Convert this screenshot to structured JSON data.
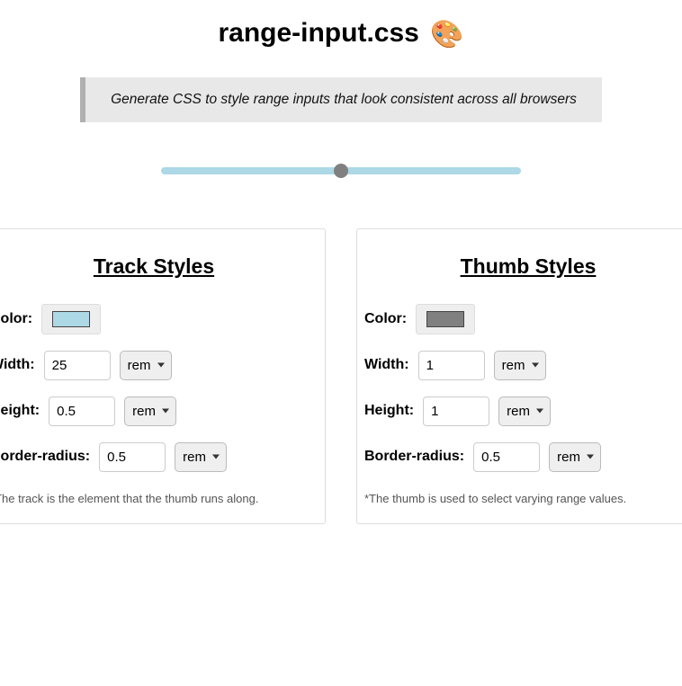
{
  "header": {
    "title": "range-input.css",
    "icon": "🎨",
    "description": "Generate CSS to style range inputs that look consistent across all browsers"
  },
  "demo": {
    "track_color": "#add8e6",
    "thumb_color": "#808080",
    "value": 50
  },
  "track": {
    "title": "Track Styles",
    "labels": {
      "color": "Color:",
      "width": "Width:",
      "height": "Height:",
      "border_radius": "Border-radius:"
    },
    "color": "#add8e6",
    "width_value": "25",
    "width_unit": "rem",
    "height_value": "0.5",
    "height_unit": "rem",
    "border_radius_value": "0.5",
    "border_radius_unit": "rem",
    "note": "*The track is the element that the thumb runs along."
  },
  "thumb": {
    "title": "Thumb Styles",
    "labels": {
      "color": "Color:",
      "width": "Width:",
      "height": "Height:",
      "border_radius": "Border-radius:"
    },
    "color": "#808080",
    "width_value": "1",
    "width_unit": "rem",
    "height_value": "1",
    "height_unit": "rem",
    "border_radius_value": "0.5",
    "border_radius_unit": "rem",
    "note": "*The thumb is used to select varying range values."
  }
}
